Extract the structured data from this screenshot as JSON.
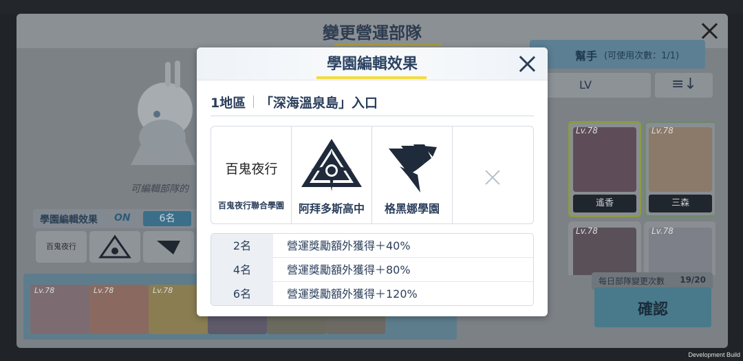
{
  "background": {
    "window_title": "變更營運部隊",
    "helper": {
      "label": "幫手",
      "sub": "(可使用次數：1/1)"
    },
    "lv_sort": "LV",
    "sort_icon": "≡↓",
    "helper_cards": [
      {
        "lv": "Lv.78",
        "name": "遙香"
      },
      {
        "lv": "Lv.78",
        "name": "三森"
      },
      {
        "lv": "Lv.78",
        "name": ""
      },
      {
        "lv": "Lv.78",
        "name": ""
      }
    ],
    "editable_text": "可編輯部隊的",
    "effect_bar": {
      "label": "學園編輯效果",
      "status": "ON",
      "count": "6名"
    },
    "mini_logos": [
      "百鬼夜行",
      "",
      ""
    ],
    "bottom_cards": [
      "Lv.78",
      "Lv.78",
      "Lv.78"
    ],
    "daily_change": {
      "label": "每日部隊變更次數",
      "value": "19/20"
    },
    "confirm_label": "確認",
    "dev_build": "Development Build"
  },
  "modal": {
    "title": "學園編輯效果",
    "area_number": "1地區",
    "area_name": "「深海溫泉島」入口",
    "schools": [
      {
        "name": "百鬼夜行聯合學園",
        "logo": "hyakkiyako-logo",
        "logo_text": "百鬼夜行"
      },
      {
        "name": "阿拜多斯高中",
        "logo": "abydos-logo"
      },
      {
        "name": "格黑娜學園",
        "logo": "gehenna-logo"
      },
      {
        "name": "",
        "logo": "empty-slot-icon"
      }
    ],
    "bonuses": [
      {
        "count": "2名",
        "text": "營運獎勵額外獲得＋40%"
      },
      {
        "count": "4名",
        "text": "營運獎勵額外獲得＋80%"
      },
      {
        "count": "6名",
        "text": "營運獎勵額外獲得＋120%"
      }
    ]
  },
  "colors": {
    "text_primary": "#2b3f5c",
    "title_underline": "#f2dc3e",
    "dim_overlay": "#000000"
  }
}
